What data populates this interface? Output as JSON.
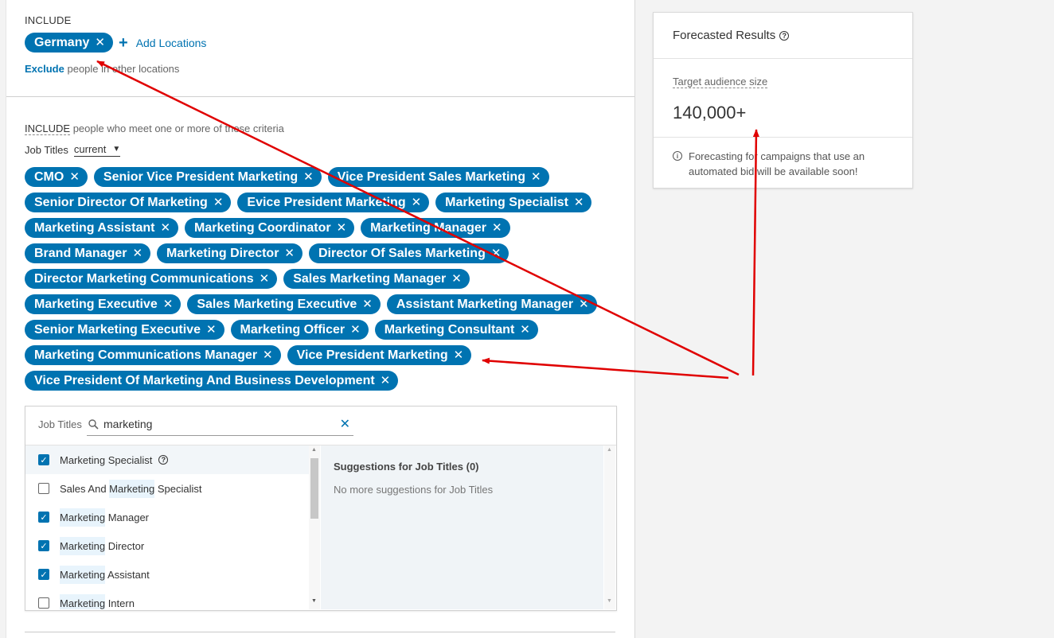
{
  "locations": {
    "include_label": "INCLUDE",
    "selected": [
      "Germany"
    ],
    "add_label": "Add Locations",
    "exclude_link": "Exclude",
    "exclude_text": "people in other locations"
  },
  "criteria": {
    "include_label": "INCLUDE",
    "include_text": "people who meet one or more of these criteria",
    "field_label": "Job Titles",
    "mode_value": "current",
    "tags": [
      "CMO",
      "Senior Vice President Marketing",
      "Vice President Sales Marketing",
      "Senior Director Of Marketing",
      "Evice President Marketing",
      "Marketing Specialist",
      "Marketing Assistant",
      "Marketing Coordinator",
      "Marketing Manager",
      "Brand Manager",
      "Marketing Director",
      "Director Of Sales Marketing",
      "Director Marketing Communications",
      "Sales Marketing Manager",
      "Marketing Executive",
      "Sales Marketing Executive",
      "Assistant Marketing Manager",
      "Senior Marketing Executive",
      "Marketing Officer",
      "Marketing Consultant",
      "Marketing Communications Manager",
      "Vice President Marketing",
      "Vice President Of Marketing And Business Development"
    ]
  },
  "search": {
    "label": "Job Titles",
    "value": "marketing",
    "results": [
      {
        "pre": "",
        "hl": "",
        "post": "Marketing Specialist",
        "checked": true,
        "help": true
      },
      {
        "pre": "Sales And ",
        "hl": "Marketing",
        "post": " Specialist",
        "checked": false,
        "help": false
      },
      {
        "pre": "",
        "hl": "Marketing",
        "post": " Manager",
        "checked": true,
        "help": false
      },
      {
        "pre": "",
        "hl": "Marketing",
        "post": " Director",
        "checked": true,
        "help": false
      },
      {
        "pre": "",
        "hl": "Marketing",
        "post": " Assistant",
        "checked": true,
        "help": false
      },
      {
        "pre": "",
        "hl": "Marketing",
        "post": " Intern",
        "checked": false,
        "help": false
      }
    ],
    "suggestions_title": "Suggestions for Job Titles (0)",
    "suggestions_empty": "No more suggestions for Job Titles"
  },
  "forecast": {
    "title": "Forecasted Results",
    "audience_label": "Target audience size",
    "audience_value": "140,000+",
    "note": "Forecasting for campaigns that use an automated bid will be available soon!"
  },
  "colors": {
    "accent": "#0073b1",
    "arrow": "#e00000"
  }
}
